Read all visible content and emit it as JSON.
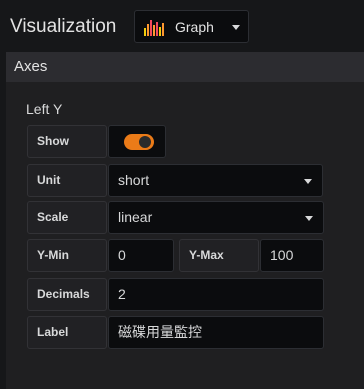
{
  "header": {
    "title": "Visualization",
    "viz_picker": {
      "label": "Graph",
      "icon": "graph-bars-icon"
    }
  },
  "axes": {
    "title": "Axes",
    "left_y": {
      "title": "Left Y",
      "show": {
        "label": "Show",
        "value": true,
        "color": "#eb7b18"
      },
      "unit": {
        "label": "Unit",
        "value": "short"
      },
      "scale": {
        "label": "Scale",
        "value": "linear"
      },
      "y_min": {
        "label": "Y-Min",
        "value": "0"
      },
      "y_max": {
        "label": "Y-Max",
        "value": "100"
      },
      "decimals": {
        "label": "Decimals",
        "value": "2"
      },
      "axis_label": {
        "label": "Label",
        "value": "磁碟用量監控"
      }
    }
  }
}
